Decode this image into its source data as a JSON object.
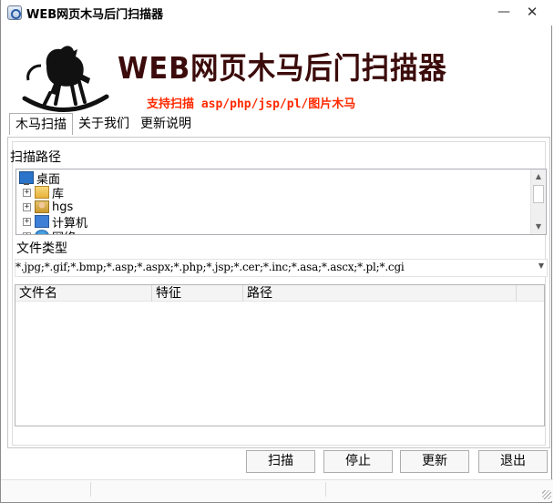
{
  "window": {
    "title": "WEB网页木马后门扫描器",
    "minimize_glyph": "—",
    "close_glyph": "✕"
  },
  "banner": {
    "title": "WEB网页木马后门扫描器",
    "subtitle": "支持扫描 asp/php/jsp/pl/图片木马",
    "title_color": "#3c0b0b",
    "subtitle_color": "#ff2a00"
  },
  "menu": {
    "items": [
      {
        "label": "木马扫描"
      },
      {
        "label": "关于我们"
      },
      {
        "label": "更新说明"
      }
    ]
  },
  "scan_path": {
    "label": "扫描路径",
    "tree": [
      {
        "label": "桌面",
        "icon": "desktop-icon",
        "expandable": false
      },
      {
        "label": "库",
        "icon": "library-icon",
        "expandable": true
      },
      {
        "label": "hgs",
        "icon": "user-folder-icon",
        "expandable": true
      },
      {
        "label": "计算机",
        "icon": "computer-icon",
        "expandable": true
      },
      {
        "label": "网络",
        "icon": "network-icon",
        "expandable": true
      }
    ]
  },
  "file_type": {
    "label": "文件类型",
    "value": "*.jpg;*.gif;*.bmp;*.asp;*.aspx;*.php;*.jsp;*.cer;*.inc;*.asa;*.ascx;*.pl;*.cgi"
  },
  "results": {
    "columns": [
      "文件名",
      "特征",
      "路径"
    ]
  },
  "buttons": {
    "scan": "扫描",
    "stop": "停止",
    "update": "更新",
    "exit": "退出"
  }
}
